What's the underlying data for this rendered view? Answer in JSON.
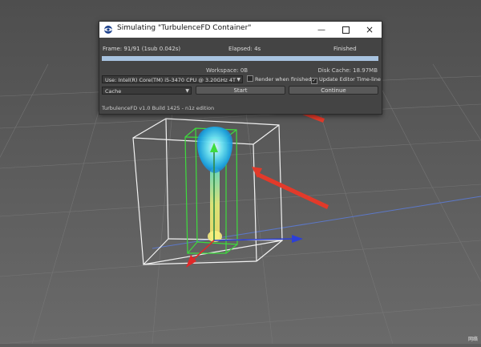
{
  "window": {
    "title": "Simulating \"TurbulenceFD Container\"",
    "minimize_icon": "minimize-icon",
    "maximize_icon": "maximize-icon",
    "close_icon": "close-icon"
  },
  "status": {
    "frame": "Frame: 91/91 (1sub 0.042s)",
    "elapsed": "Elapsed: 4s",
    "state": "Finished",
    "progress": 1.0
  },
  "info": {
    "workspace": "Workspace: 0B",
    "disk_cache": "Disk Cache: 18.97MB"
  },
  "controls": {
    "device": "Use: Intel(R) Core(TM) i5-3470 CPU @ 3.20GHz 4T",
    "render_when_finished": "Render when finished",
    "render_when_finished_checked": false,
    "update_editor": "Update Editor Time-line",
    "update_editor_checked": true,
    "cache_mode": "Cache",
    "start": "Start",
    "continue": "Continue"
  },
  "footer": "TurbulenceFD v1.0 Build 1425 - n1z edition",
  "watermark": "网络"
}
